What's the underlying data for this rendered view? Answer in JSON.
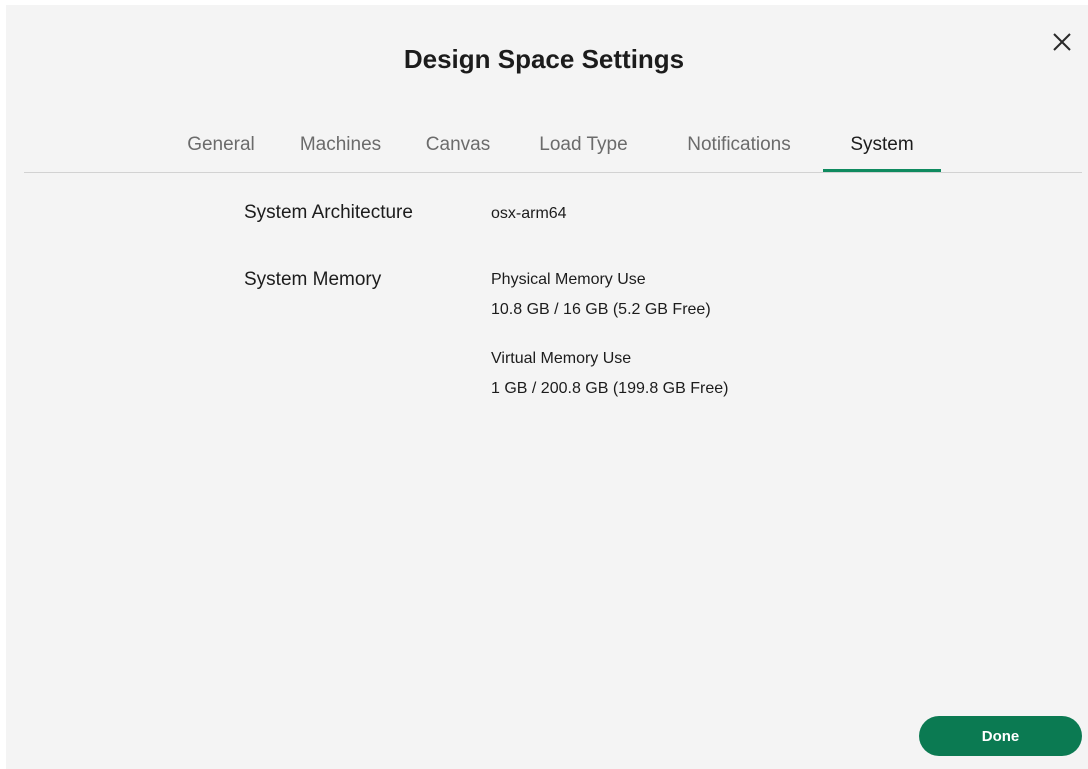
{
  "dialog": {
    "title": "Design Space Settings",
    "close_icon": "close-icon"
  },
  "tabs": [
    {
      "label": "General",
      "active": false
    },
    {
      "label": "Machines",
      "active": false
    },
    {
      "label": "Canvas",
      "active": false
    },
    {
      "label": "Load Type",
      "active": false
    },
    {
      "label": "Notifications",
      "active": false
    },
    {
      "label": "System",
      "active": true
    }
  ],
  "system": {
    "architecture_label": "System Architecture",
    "architecture_value": "osx-arm64",
    "memory_label": "System Memory",
    "physical_memory_title": "Physical Memory Use",
    "physical_memory_value": "10.8 GB / 16 GB (5.2 GB Free)",
    "virtual_memory_title": "Virtual Memory Use",
    "virtual_memory_value": "1 GB / 200.8 GB (199.8 GB Free)"
  },
  "footer": {
    "done_label": "Done"
  },
  "colors": {
    "accent": "#0b7a52",
    "active_tab_indicator": "#0f8a5f",
    "background": "#f4f4f4"
  }
}
